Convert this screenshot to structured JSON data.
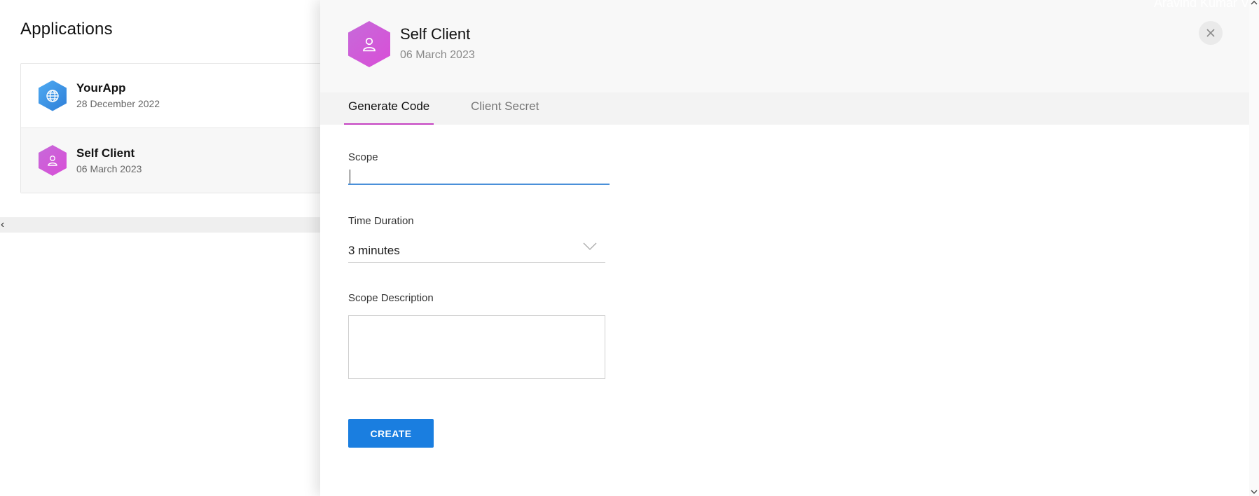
{
  "page": {
    "title": "Applications"
  },
  "apps": [
    {
      "name": "YourApp",
      "date": "28 December 2022",
      "icon": "globe-icon",
      "color": "#3a8fe4"
    },
    {
      "name": "Self Client",
      "date": "06 March 2023",
      "icon": "user-icon",
      "color": "#d05ad8"
    }
  ],
  "drawer": {
    "title": "Self Client",
    "date": "06 March 2023",
    "icon": "user-icon",
    "user_name": "Aravind Kumar V",
    "tabs": [
      {
        "label": "Generate Code",
        "active": true
      },
      {
        "label": "Client Secret",
        "active": false
      }
    ],
    "form": {
      "scope_label": "Scope",
      "scope_value": "",
      "duration_label": "Time Duration",
      "duration_value": "3 minutes",
      "description_label": "Scope Description",
      "description_value": "",
      "create_label": "CREATE"
    }
  },
  "colors": {
    "accent": "#c542c2",
    "primary_button": "#1a7ee0",
    "input_focus": "#4a90d9"
  }
}
